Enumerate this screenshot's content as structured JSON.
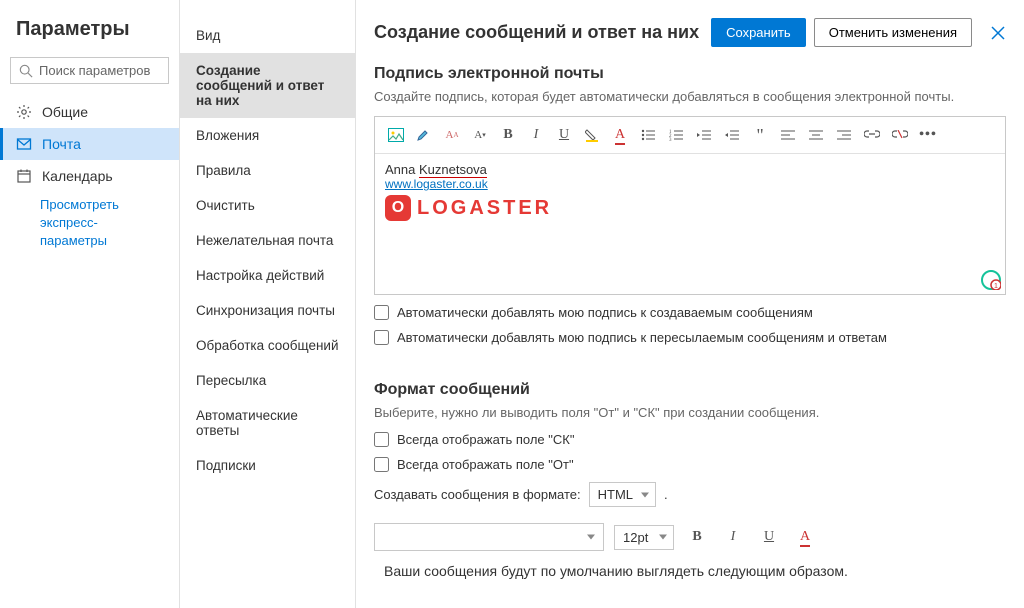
{
  "sidebar": {
    "title": "Параметры",
    "search_placeholder": "Поиск параметров",
    "items": [
      {
        "label": "Общие"
      },
      {
        "label": "Почта"
      },
      {
        "label": "Календарь"
      }
    ],
    "express_link": "Просмотреть экспресс-параметры"
  },
  "subnav": [
    "Вид",
    "Создание сообщений и ответ на них",
    "Вложения",
    "Правила",
    "Очистить",
    "Нежелательная почта",
    "Настройка действий",
    "Синхронизация почты",
    "Обработка сообщений",
    "Пересылка",
    "Автоматические ответы",
    "Подписки"
  ],
  "main": {
    "title": "Создание сообщений и ответ на них",
    "save": "Сохранить",
    "cancel": "Отменить изменения",
    "sig_title": "Подпись электронной почты",
    "sig_desc": "Создайте подпись, которая будет автоматически добавляться в сообщения электронной почты.",
    "sig_name_first": "Anna ",
    "sig_name_last": "Kuznetsova",
    "sig_url": "www.logaster.co.uk",
    "logo_text": "LOGASTER",
    "chk1": "Автоматически добавлять мою подпись к создаваемым сообщениям",
    "chk2": "Автоматически добавлять мою подпись к пересылаемым сообщениям и ответам",
    "fmt_title": "Формат сообщений",
    "fmt_desc": "Выберите, нужно ли выводить поля \"От\" и \"СК\" при создании сообщения.",
    "chk3": "Всегда отображать поле \"СК\"",
    "chk4": "Всегда отображать поле \"От\"",
    "compose_label": "Создавать сообщения в формате:",
    "compose_value": "HTML",
    "font_size": "12pt",
    "preview": "Ваши сообщения будут по умолчанию выглядеть следующим образом."
  }
}
